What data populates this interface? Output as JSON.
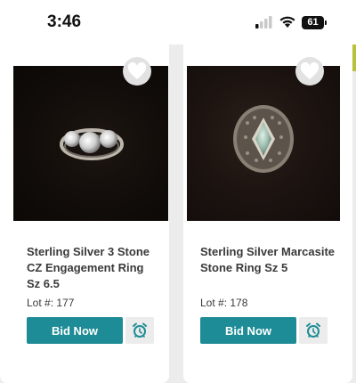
{
  "status_bar": {
    "time": "3:46",
    "battery": "61"
  },
  "lots": [
    {
      "title": "Sterling Silver 3 Stone CZ Engagement Ring Sz 6.5",
      "lot": "Lot #: 177",
      "bid_label": "Bid Now",
      "image_icon": "ring-photo"
    },
    {
      "title": "Sterling Silver Marcasite Stone Ring Sz 5",
      "lot": "Lot #: 178",
      "bid_label": "Bid Now",
      "image_icon": "ring-photo"
    }
  ],
  "colors": {
    "accent": "#1e8c96",
    "background": "#ececec",
    "card": "#ffffff"
  }
}
